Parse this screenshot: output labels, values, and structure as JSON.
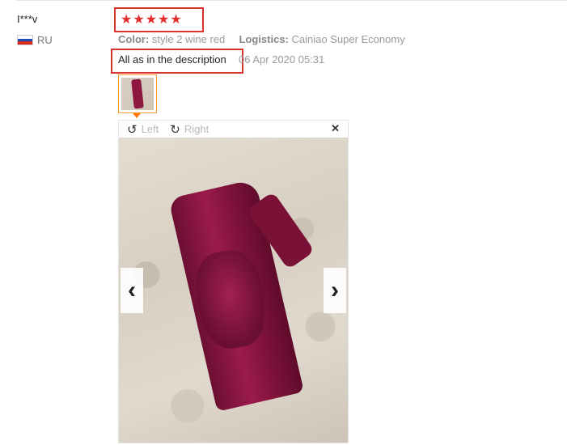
{
  "review": {
    "user": "I***v",
    "country": "RU",
    "rating": 5,
    "attributes": {
      "color_label": "Color:",
      "color_value": "style 2 wine red",
      "logistics_label": "Logistics:",
      "logistics_value": "Cainiao Super Economy"
    },
    "feedback": "All as in the description",
    "date": "06 Apr 2020 05:31"
  },
  "viewer": {
    "rotate_left_label": "Left",
    "rotate_right_label": "Right",
    "close_glyph": "✕",
    "prev_glyph": "‹",
    "next_glyph": "›",
    "rotate_left_icon": "rotate-left-icon",
    "rotate_right_icon": "rotate-right-icon",
    "close_icon": "close-icon"
  },
  "colors": {
    "highlight_border": "#d9342b",
    "star": "#e62e2e",
    "thumb_border": "#ff9a2e"
  },
  "flag": [
    "#ffffff",
    "#1f4fb5",
    "#d52b1e"
  ]
}
